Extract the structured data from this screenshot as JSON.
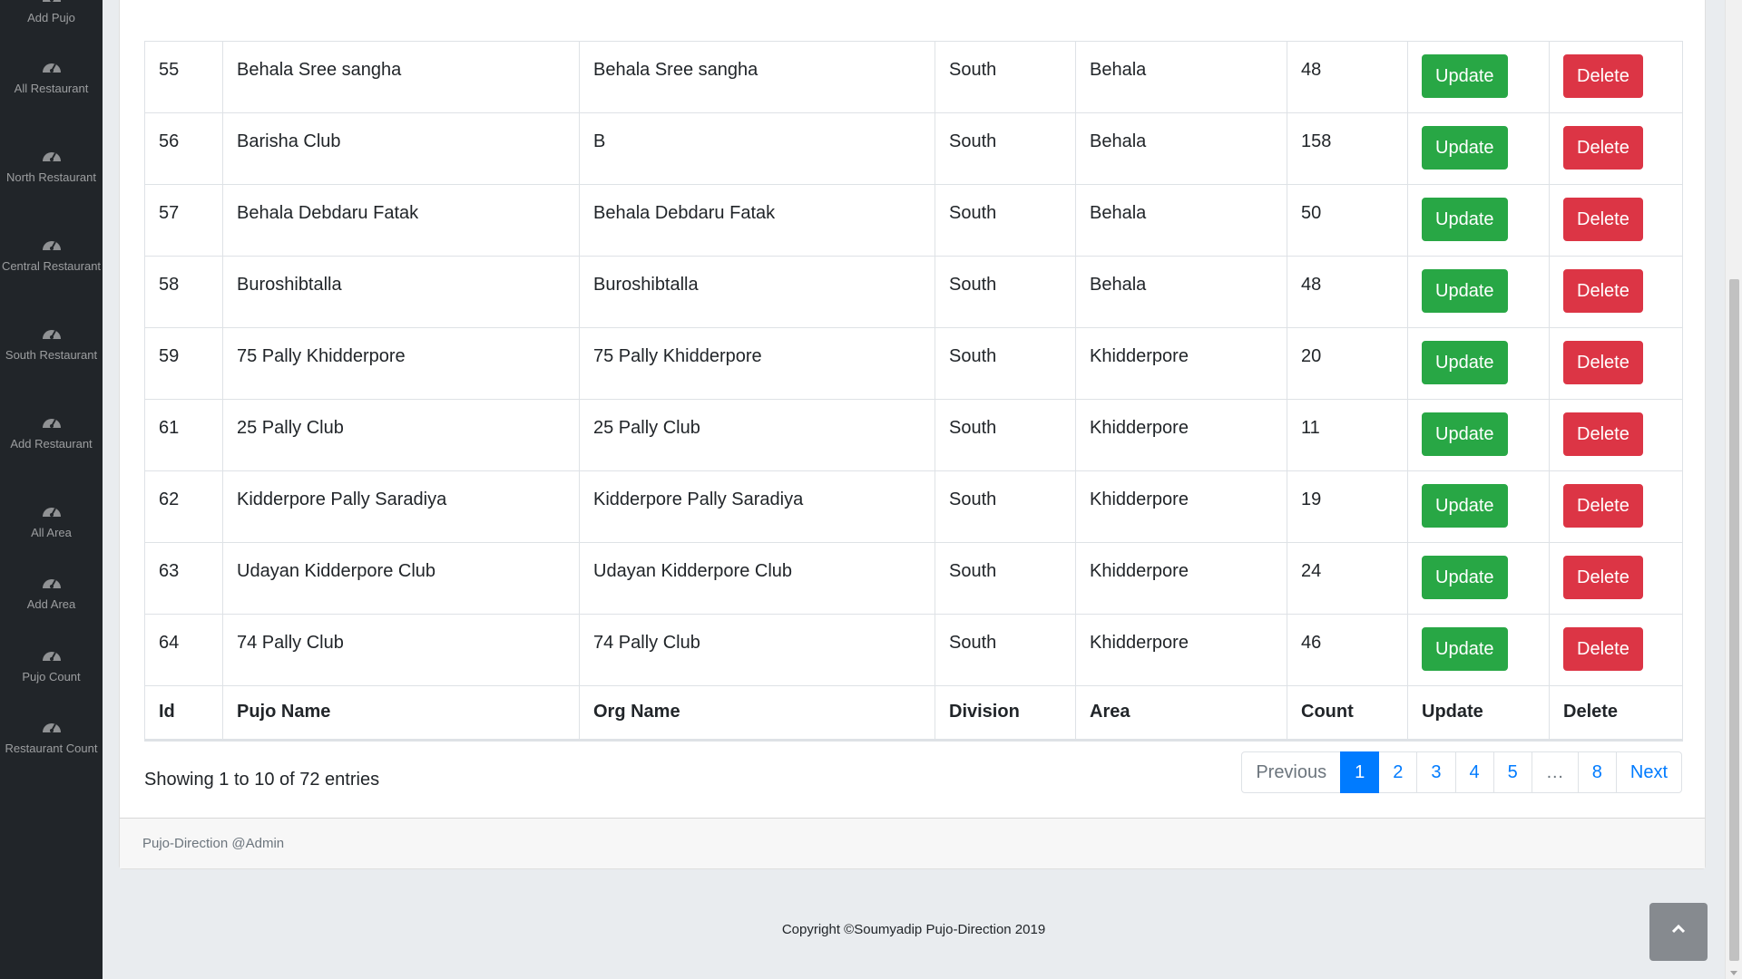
{
  "sidebar": {
    "items": [
      {
        "label": "Add Pujo",
        "icon": "speedometer-icon"
      },
      {
        "label": "All Restaurant",
        "icon": "speedometer-icon"
      },
      {
        "label": "North Restaurant",
        "icon": "speedometer-icon"
      },
      {
        "label": "Central Restaurant",
        "icon": "speedometer-icon"
      },
      {
        "label": "South Restaurant",
        "icon": "speedometer-icon"
      },
      {
        "label": "Add Restaurant",
        "icon": "speedometer-icon"
      },
      {
        "label": "All Area",
        "icon": "speedometer-icon"
      },
      {
        "label": "Add Area",
        "icon": "speedometer-icon"
      },
      {
        "label": "Pujo Count",
        "icon": "speedometer-icon"
      },
      {
        "label": "Restaurant Count",
        "icon": "speedometer-icon"
      }
    ]
  },
  "table": {
    "columns": [
      "Id",
      "Pujo Name",
      "Org Name",
      "Division",
      "Area",
      "Count",
      "Update",
      "Delete"
    ],
    "update_label": "Update",
    "delete_label": "Delete",
    "rows": [
      {
        "id": "55",
        "pujo": "Behala Sree sangha",
        "org": "Behala Sree sangha",
        "division": "South",
        "area": "Behala",
        "count": "48"
      },
      {
        "id": "56",
        "pujo": "Barisha Club",
        "org": "B",
        "division": "South",
        "area": "Behala",
        "count": "158"
      },
      {
        "id": "57",
        "pujo": "Behala Debdaru Fatak",
        "org": "Behala Debdaru Fatak",
        "division": "South",
        "area": "Behala",
        "count": "50"
      },
      {
        "id": "58",
        "pujo": "Buroshibtalla",
        "org": "Buroshibtalla",
        "division": "South",
        "area": "Behala",
        "count": "48"
      },
      {
        "id": "59",
        "pujo": "75 Pally Khidderpore",
        "org": "75 Pally Khidderpore",
        "division": "South",
        "area": "Khidderpore",
        "count": "20"
      },
      {
        "id": "61",
        "pujo": "25 Pally Club",
        "org": "25 Pally Club",
        "division": "South",
        "area": "Khidderpore",
        "count": "11"
      },
      {
        "id": "62",
        "pujo": "Kidderpore Pally Saradiya",
        "org": "Kidderpore Pally Saradiya",
        "division": "South",
        "area": "Khidderpore",
        "count": "19"
      },
      {
        "id": "63",
        "pujo": "Udayan Kidderpore Club",
        "org": "Udayan Kidderpore Club",
        "division": "South",
        "area": "Khidderpore",
        "count": "24"
      },
      {
        "id": "64",
        "pujo": "74 Pally Club",
        "org": "74 Pally Club",
        "division": "South",
        "area": "Khidderpore",
        "count": "46"
      }
    ]
  },
  "info": "Showing 1 to 10 of 72 entries",
  "pagination": {
    "previous": "Previous",
    "pages": [
      "1",
      "2",
      "3",
      "4",
      "5",
      "…",
      "8"
    ],
    "active": "1",
    "next": "Next"
  },
  "card_footer": "Pujo-Direction @Admin",
  "copyright": "Copyright ©Soumyadip Pujo-Direction 2019",
  "colors": {
    "sidebar_bg": "#212529",
    "update": "#28a745",
    "delete": "#dc3545",
    "primary": "#007bff"
  }
}
